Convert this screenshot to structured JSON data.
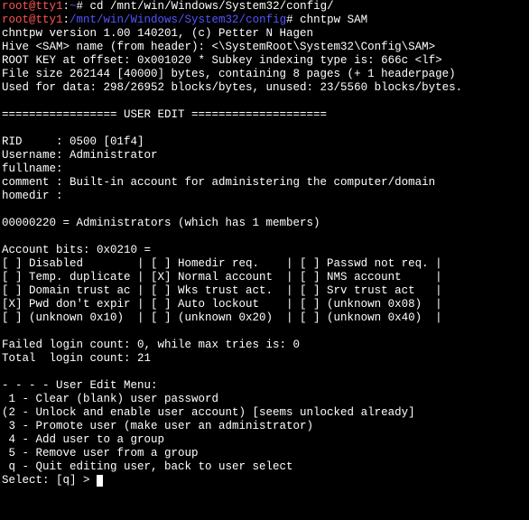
{
  "lines": [
    [
      {
        "cls": "red",
        "txt": "root@tty1"
      },
      {
        "cls": "",
        "txt": ":"
      },
      {
        "cls": "blue",
        "txt": "~"
      },
      {
        "cls": "",
        "txt": "# cd /mnt/win/Windows/System32/config/"
      }
    ],
    [
      {
        "cls": "red",
        "txt": "root@tty1"
      },
      {
        "cls": "",
        "txt": ":"
      },
      {
        "cls": "blue",
        "txt": "/mnt/win/Windows/System32/config"
      },
      {
        "cls": "",
        "txt": "# chntpw SAM"
      }
    ],
    [
      {
        "cls": "",
        "txt": "chntpw version 1.00 140201, (c) Petter N Hagen"
      }
    ],
    [
      {
        "cls": "",
        "txt": "Hive <SAM> name (from header): <\\SystemRoot\\System32\\Config\\SAM>"
      }
    ],
    [
      {
        "cls": "",
        "txt": "ROOT KEY at offset: 0x001020 * Subkey indexing type is: 666c <lf>"
      }
    ],
    [
      {
        "cls": "",
        "txt": "File size 262144 [40000] bytes, containing 8 pages (+ 1 headerpage)"
      }
    ],
    [
      {
        "cls": "",
        "txt": "Used for data: 298/26952 blocks/bytes, unused: 23/5560 blocks/bytes."
      }
    ],
    [
      {
        "cls": "",
        "txt": ""
      }
    ],
    [
      {
        "cls": "",
        "txt": "================= USER EDIT ===================="
      }
    ],
    [
      {
        "cls": "",
        "txt": ""
      }
    ],
    [
      {
        "cls": "",
        "txt": "RID     : 0500 [01f4]"
      }
    ],
    [
      {
        "cls": "",
        "txt": "Username: Administrator"
      }
    ],
    [
      {
        "cls": "",
        "txt": "fullname:"
      }
    ],
    [
      {
        "cls": "",
        "txt": "comment : Built-in account for administering the computer/domain"
      }
    ],
    [
      {
        "cls": "",
        "txt": "homedir :"
      }
    ],
    [
      {
        "cls": "",
        "txt": ""
      }
    ],
    [
      {
        "cls": "",
        "txt": "00000220 = Administrators (which has 1 members)"
      }
    ],
    [
      {
        "cls": "",
        "txt": ""
      }
    ],
    [
      {
        "cls": "",
        "txt": "Account bits: 0x0210 ="
      }
    ],
    [
      {
        "cls": "",
        "txt": "[ ] Disabled        | [ ] Homedir req.    | [ ] Passwd not req. |"
      }
    ],
    [
      {
        "cls": "",
        "txt": "[ ] Temp. duplicate | [X] Normal account  | [ ] NMS account     |"
      }
    ],
    [
      {
        "cls": "",
        "txt": "[ ] Domain trust ac | [ ] Wks trust act.  | [ ] Srv trust act   |"
      }
    ],
    [
      {
        "cls": "",
        "txt": "[X] Pwd don't expir | [ ] Auto lockout    | [ ] (unknown 0x08)  |"
      }
    ],
    [
      {
        "cls": "",
        "txt": "[ ] (unknown 0x10)  | [ ] (unknown 0x20)  | [ ] (unknown 0x40)  |"
      }
    ],
    [
      {
        "cls": "",
        "txt": ""
      }
    ],
    [
      {
        "cls": "",
        "txt": "Failed login count: 0, while max tries is: 0"
      }
    ],
    [
      {
        "cls": "",
        "txt": "Total  login count: 21"
      }
    ],
    [
      {
        "cls": "",
        "txt": ""
      }
    ],
    [
      {
        "cls": "",
        "txt": "- - - - User Edit Menu:"
      }
    ],
    [
      {
        "cls": "",
        "txt": " 1 - Clear (blank) user password"
      }
    ],
    [
      {
        "cls": "",
        "txt": "(2 - Unlock and enable user account) [seems unlocked already]"
      }
    ],
    [
      {
        "cls": "",
        "txt": " 3 - Promote user (make user an administrator)"
      }
    ],
    [
      {
        "cls": "",
        "txt": " 4 - Add user to a group"
      }
    ],
    [
      {
        "cls": "",
        "txt": " 5 - Remove user from a group"
      }
    ],
    [
      {
        "cls": "",
        "txt": " q - Quit editing user, back to user select"
      }
    ]
  ],
  "prompt": "Select: [q] > "
}
